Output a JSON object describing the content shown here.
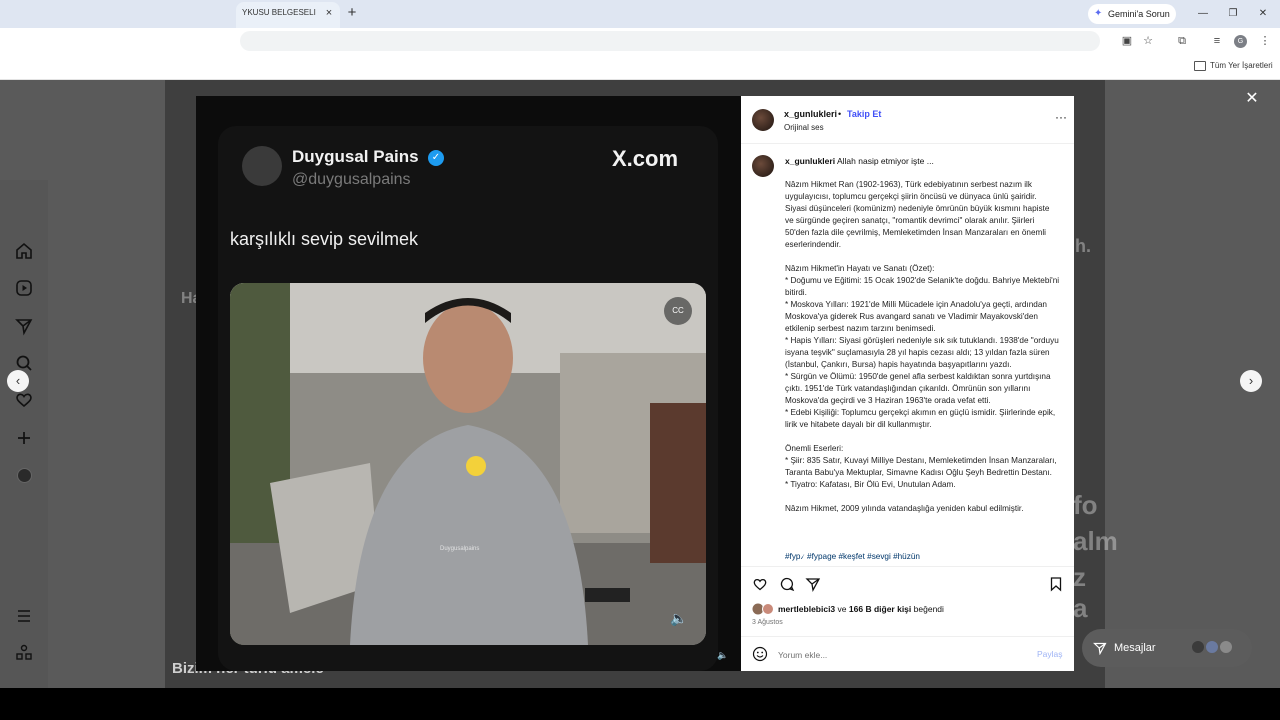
{
  "browser": {
    "tab_title": "YKUSU BELGESELI FU",
    "tab_close": "×",
    "new_tab": "+",
    "gemini_label": "Gemini'a Sorun",
    "bookmarks_label": "Tüm Yer İşaretleri",
    "profile_initial": "G",
    "window_controls": {
      "minimize": "—",
      "restore": "❐",
      "close": "✕"
    }
  },
  "video": {
    "author_name": "Duygusal Pains",
    "author_handle": "@duygusalpains",
    "site": "X.com",
    "caption": "karşılıklı sevip sevilmek",
    "cc_label": "CC",
    "watermark": "Duygusalpains"
  },
  "post": {
    "username": "x_gunlukleri",
    "separator": "•",
    "follow_label": "Takip Et",
    "audio": "Orijinal ses",
    "caption_user": "x_gunlukleri",
    "caption_first_line": "Allah nasip etmiyor işte ...",
    "caption_body": "Nâzım Hikmet Ran (1902-1963), Türk edebiyatının serbest nazım ilk uygulayıcısı, toplumcu gerçekçi şiirin öncüsü ve dünyaca ünlü şairidir. Siyasi düşünceleri (komünizm) nedeniyle ömrünün büyük kısmını hapiste ve sürgünde geçiren sanatçı, \"romantik devrimci\" olarak anılır. Şiirleri 50'den fazla dile çevrilmiş, Memleketimden İnsan Manzaraları en önemli eserlerindendir.\n\nNâzım Hikmet'in Hayatı ve Sanatı (Özet):\n* Doğumu ve Eğitimi: 15 Ocak 1902'de Selanik'te doğdu. Bahriye Mektebi'ni bitirdi.\n* Moskova Yılları: 1921'de Milli Mücadele için Anadolu'ya geçti, ardından Moskova'ya giderek Rus avangard sanatı ve Vladimir Mayakovski'den etkilenip serbest nazım tarzını benimsedi.\n* Hapis Yılları: Siyasi görüşleri nedeniyle sık sık tutuklandı. 1938'de \"orduyu isyana teşvik\" suçlamasıyla 28 yıl hapis cezası aldı; 13 yıldan fazla süren (İstanbul, Çankırı, Bursa) hapis hayatında başyapıtlarını yazdı.\n* Sürgün ve Ölümü: 1950'de genel afla serbest kaldıktan sonra yurtdışına çıktı. 1951'de Türk vatandaşlığından çıkarıldı. Ömrünün son yıllarını Moskova'da geçirdi ve 3 Haziran 1963'te orada vefat etti.\n* Edebi Kişiliği: Toplumcu gerçekçi akımın en güçlü ismidir. Şiirlerinde epik, lirik ve hitabete dayalı bir dil kullanmıştır.\n\nÖnemli Eserleri:\n* Şiir: 835 Satır, Kuvayi Milliye Destanı, Memleketimden İnsan Manzaraları, Taranta Babu'ya Mektuplar, Simavne Kadısı Oğlu Şeyh Bedrettin Destanı.\n* Tiyatro: Kafatası, Bir Ölü Evi, Unutulan Adam.\n\nNâzım Hikmet, 2009 yılında vatandaşlığa yeniden kabul edilmiştir.",
    "hashtags": "#fyp৴ #fypage #keşfet #sevgi #hüzün",
    "likes_user": "mertleblebici3",
    "likes_mid": "ve",
    "likes_count": "166 B diğer kişi",
    "likes_suffix": "beğendi",
    "date": "3 Ağustos",
    "comment_placeholder": "Yorum ekle...",
    "share_label": "Paylaş"
  },
  "nav": {
    "close": "✕",
    "prev": "‹",
    "next": "›",
    "messages_label": "Mesajlar"
  },
  "background": {
    "ghost_a": "Ha",
    "ghost_b": "h.",
    "ghost_c": "fo",
    "ghost_d": "alm",
    "ghost_e": "z a",
    "bottom_caption": "Bizim her türlü amele"
  }
}
